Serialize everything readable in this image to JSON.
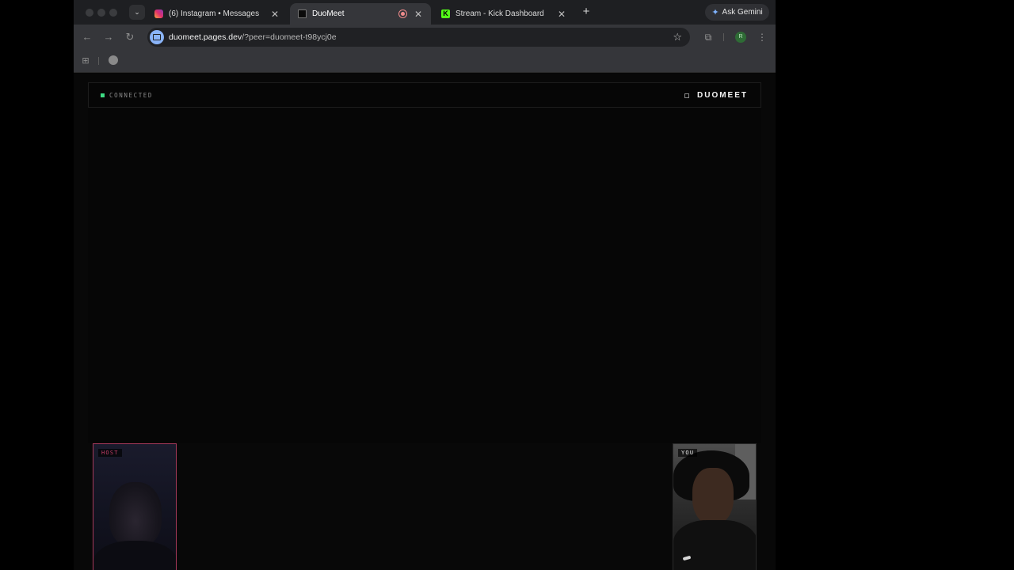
{
  "browser": {
    "tabs": [
      {
        "title": "(6) Instagram • Messages",
        "close": "✕",
        "favicon": "instagram-icon"
      },
      {
        "title": "DuoMeet",
        "close": "✕",
        "favicon": "duomeet-icon",
        "recording": true,
        "active": true
      },
      {
        "title": "Stream - Kick Dashboard",
        "close": "✕",
        "favicon": "kick-icon",
        "favicon_letter": "K"
      }
    ],
    "tab_search_glyph": "⌄",
    "new_tab_glyph": "+",
    "gemini_label": "Ask Gemini",
    "url_host": "duomeet.pages.dev",
    "url_path": "/?peer=duomeet-t98ycj0e",
    "profile_initial": "R",
    "icons": {
      "back": "←",
      "forward": "→",
      "reload": "↻",
      "star": "☆",
      "extensions": "⧉",
      "menu": "⋮",
      "apps": "⊞"
    }
  },
  "app": {
    "status_text": "CONNECTED",
    "brand_name": "DUOMEET",
    "host_label": "HOST",
    "you_label": "YOU",
    "colors": {
      "status_green": "#3ddc84",
      "host_accent": "#a83a5b"
    }
  }
}
